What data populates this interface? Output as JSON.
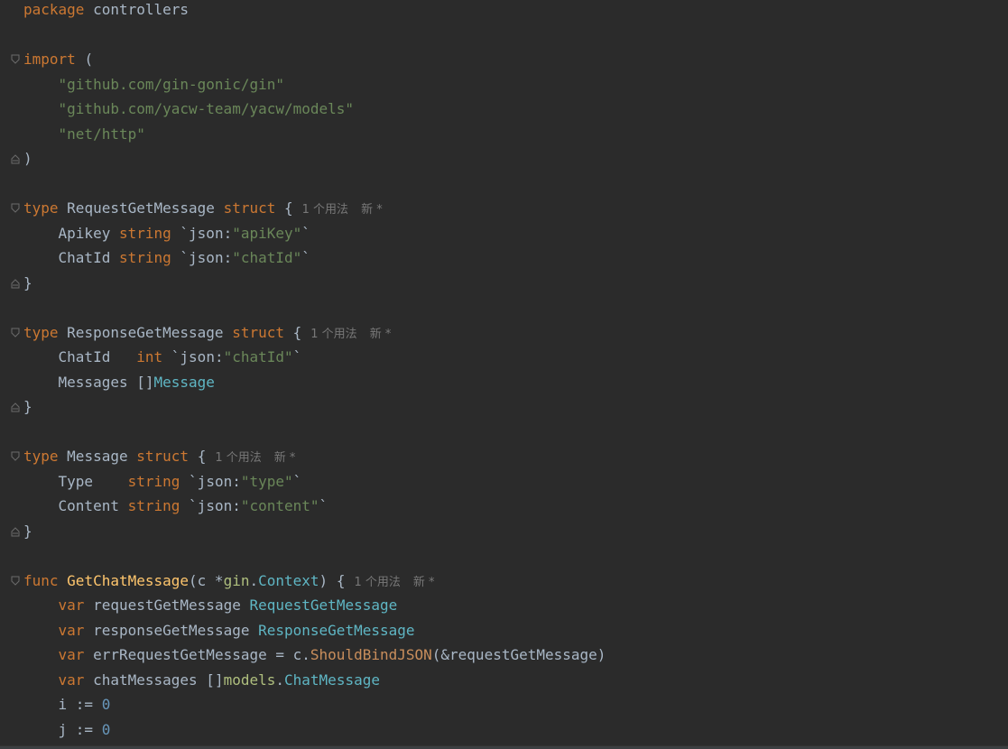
{
  "colors": {
    "background": "#2b2b2b",
    "keyword": "#cc7832",
    "string": "#6a8759",
    "type_ref": "#5fb6c4",
    "function_decl": "#ffc66d",
    "method_call": "#c98e5c",
    "number": "#6897bb",
    "package_ref": "#afbf7e",
    "text": "#a9b7c6",
    "inlay_hint": "#787878"
  },
  "hints": {
    "usages": "1 个用法",
    "new": "新 *"
  },
  "code": {
    "l1": {
      "kw": "package",
      "name": "controllers"
    },
    "l3": {
      "kw": "import",
      "paren": "("
    },
    "l4": {
      "str": "\"github.com/gin-gonic/gin\""
    },
    "l5": {
      "str": "\"github.com/yacw-team/yacw/models\""
    },
    "l6": {
      "str": "\"net/http\""
    },
    "l7": {
      "close": ")"
    },
    "l9": {
      "kw": "type",
      "name": "RequestGetMessage",
      "kw2": "struct",
      "brace": "{"
    },
    "l10": {
      "field": "Apikey",
      "type": "string",
      "tag_open": "`json:",
      "tag_val": "\"apiKey\"",
      "tag_close": "`"
    },
    "l11": {
      "field": "ChatId",
      "type": "string",
      "tag_open": "`json:",
      "tag_val": "\"chatId\"",
      "tag_close": "`"
    },
    "l12": {
      "close": "}"
    },
    "l14": {
      "kw": "type",
      "name": "ResponseGetMessage",
      "kw2": "struct",
      "brace": "{"
    },
    "l15": {
      "field": "ChatId  ",
      "type": "int",
      "tag_open": "`json:",
      "tag_val": "\"chatId\"",
      "tag_close": "`"
    },
    "l16": {
      "field": "Messages",
      "brackets": "[]",
      "type_ref": "Message"
    },
    "l17": {
      "close": "}"
    },
    "l19": {
      "kw": "type",
      "name": "Message",
      "kw2": "struct",
      "brace": "{"
    },
    "l20": {
      "field": "Type   ",
      "type": "string",
      "tag_open": "`json:",
      "tag_val": "\"type\"",
      "tag_close": "`"
    },
    "l21": {
      "field": "Content",
      "type": "string",
      "tag_open": "`json:",
      "tag_val": "\"content\"",
      "tag_close": "`"
    },
    "l22": {
      "close": "}"
    },
    "l24": {
      "kw": "func",
      "name": "GetChatMessage",
      "params_open": "(c *",
      "pkg": "gin",
      "dot": ".",
      "type_ref": "Context",
      "params_close": ") {"
    },
    "l25": {
      "kw": "var",
      "name": "requestGetMessage",
      "type_ref": "RequestGetMessage"
    },
    "l26": {
      "kw": "var",
      "name": "responseGetMessage",
      "type_ref": "ResponseGetMessage"
    },
    "l27": {
      "kw": "var",
      "name": "errRequestGetMessage = c.",
      "method": "ShouldBindJSON",
      "args": "(&requestGetMessage)"
    },
    "l28": {
      "kw": "var",
      "name": "chatMessages []",
      "pkg": "models",
      "dot": ".",
      "type_ref": "ChatMessage"
    },
    "l29": {
      "name": "i := ",
      "num": "0"
    },
    "l30": {
      "name": "j := ",
      "num": "0"
    }
  }
}
